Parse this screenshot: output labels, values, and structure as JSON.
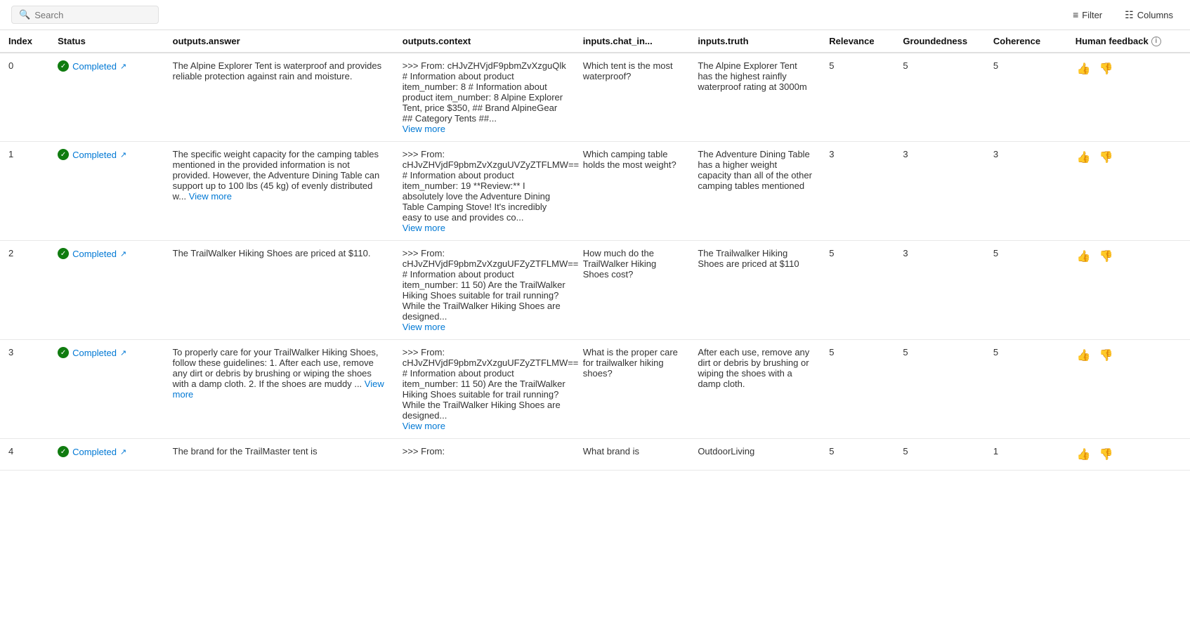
{
  "topbar": {
    "search_placeholder": "Search",
    "filter_label": "Filter",
    "columns_label": "Columns"
  },
  "table": {
    "headers": {
      "index": "Index",
      "status": "Status",
      "outputs_answer": "outputs.answer",
      "outputs_context": "outputs.context",
      "inputs_chat_in": "inputs.chat_in...",
      "inputs_truth": "inputs.truth",
      "relevance": "Relevance",
      "groundedness": "Groundedness",
      "coherence": "Coherence",
      "human_feedback": "Human feedback"
    },
    "rows": [
      {
        "index": "0",
        "status": "Completed",
        "answer": "The Alpine Explorer Tent is waterproof and provides reliable protection against rain and moisture.",
        "context": ">>> From: cHJvZHVjdF9pbmZvXzguQlk # Information about product item_number: 8 # Information about product item_number: 8 Alpine Explorer Tent, price $350, ## Brand AlpineGear ## Category Tents ##...",
        "context_has_more": true,
        "chat_in": "Which tent is the most waterproof?",
        "truth": "The Alpine Explorer Tent has the highest rainfly waterproof rating at 3000m",
        "relevance": "5",
        "groundedness": "5",
        "coherence": "5"
      },
      {
        "index": "1",
        "status": "Completed",
        "answer": "The specific weight capacity for the camping tables mentioned in the provided information is not provided. However, the Adventure Dining Table can support up to 100 lbs (45 kg) of evenly distributed w...",
        "answer_has_more": true,
        "context": ">>> From: cHJvZHVjdF9pbmZvXzguUVZyZTFLMW== # Information about product item_number: 19 **Review:** I absolutely love the Adventure Dining Table Camping Stove! It's incredibly easy to use and provides co...",
        "context_has_more": true,
        "chat_in": "Which camping table holds the most weight?",
        "truth": "The Adventure Dining Table has a higher weight capacity than all of the other camping tables mentioned",
        "relevance": "3",
        "groundedness": "3",
        "coherence": "3"
      },
      {
        "index": "2",
        "status": "Completed",
        "answer": "The TrailWalker Hiking Shoes are priced at $110.",
        "context": ">>> From: cHJvZHVjdF9pbmZvXzguUFZyZTFLMW== # Information about product item_number: 11 50) Are the TrailWalker Hiking Shoes suitable for trail running? While the TrailWalker Hiking Shoes are designed...",
        "context_has_more": true,
        "chat_in": "How much do the TrailWalker Hiking Shoes cost?",
        "truth": "The Trailwalker Hiking Shoes are priced at $110",
        "relevance": "5",
        "groundedness": "3",
        "coherence": "5"
      },
      {
        "index": "3",
        "status": "Completed",
        "answer": "To properly care for your TrailWalker Hiking Shoes, follow these guidelines: 1. After each use, remove any dirt or debris by brushing or wiping the shoes with a damp cloth. 2. If the shoes are muddy ...",
        "answer_has_more": true,
        "context": ">>> From: cHJvZHVjdF9pbmZvXzguUFZyZTFLMW== # Information about product item_number: 11 50) Are the TrailWalker Hiking Shoes suitable for trail running? While the TrailWalker Hiking Shoes are designed...",
        "context_has_more": true,
        "chat_in": "What is the proper care for trailwalker hiking shoes?",
        "truth": "After each use, remove any dirt or debris by brushing or wiping the shoes with a damp cloth.",
        "relevance": "5",
        "groundedness": "5",
        "coherence": "5"
      },
      {
        "index": "4",
        "status": "Completed",
        "answer": "The brand for the TrailMaster tent is",
        "context": ">>> From:",
        "chat_in": "What brand is",
        "truth": "OutdoorLiving",
        "relevance": "5",
        "groundedness": "5",
        "coherence": "1"
      }
    ]
  }
}
